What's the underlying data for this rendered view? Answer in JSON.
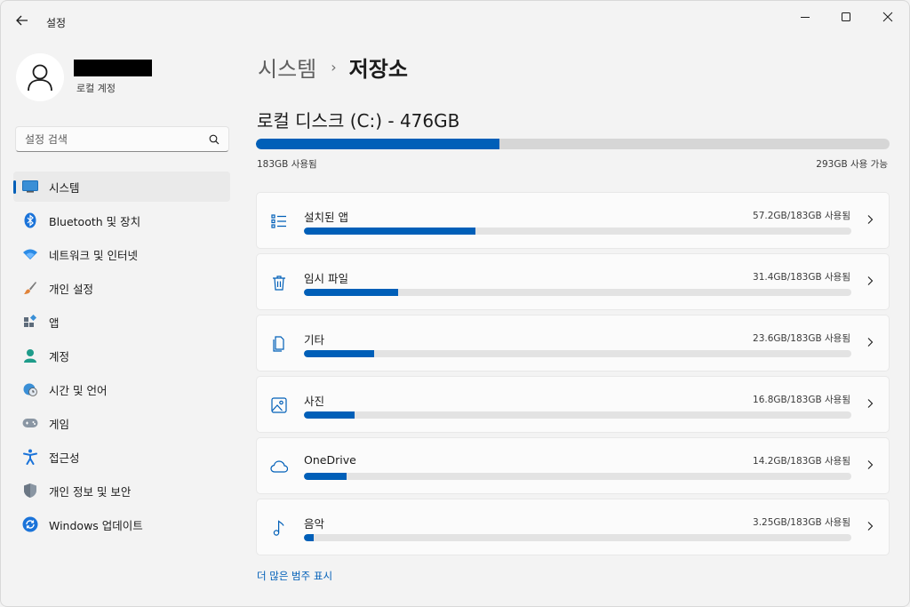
{
  "app": {
    "title": "설정"
  },
  "profile": {
    "subtitle": "로컬 계정"
  },
  "search": {
    "placeholder": "설정 검색"
  },
  "nav": {
    "items": [
      {
        "label": "시스템",
        "icon": "system-icon",
        "active": true
      },
      {
        "label": "Bluetooth 및 장치",
        "icon": "bluetooth-icon"
      },
      {
        "label": "네트워크 및 인터넷",
        "icon": "wifi-icon"
      },
      {
        "label": "개인 설정",
        "icon": "brush-icon"
      },
      {
        "label": "앱",
        "icon": "apps-icon"
      },
      {
        "label": "계정",
        "icon": "account-icon"
      },
      {
        "label": "시간 및 언어",
        "icon": "globe-clock-icon"
      },
      {
        "label": "게임",
        "icon": "gamepad-icon"
      },
      {
        "label": "접근성",
        "icon": "accessibility-icon"
      },
      {
        "label": "개인 정보 및 보안",
        "icon": "shield-icon"
      },
      {
        "label": "Windows 업데이트",
        "icon": "update-icon"
      }
    ]
  },
  "breadcrumb": {
    "parent": "시스템",
    "separator": "›",
    "current": "저장소"
  },
  "disk": {
    "title": "로컬 디스크 (C:) - 476GB",
    "used_label": "183GB 사용됨",
    "free_label": "293GB 사용 가능",
    "used_fraction": 0.3845
  },
  "categories": [
    {
      "label": "설치된 앱",
      "usage": "57.2GB/183GB 사용됨",
      "fraction": 0.3126,
      "icon": "apps-list-icon"
    },
    {
      "label": "임시 파일",
      "usage": "31.4GB/183GB 사용됨",
      "fraction": 0.1716,
      "icon": "trash-icon"
    },
    {
      "label": "기타",
      "usage": "23.6GB/183GB 사용됨",
      "fraction": 0.129,
      "icon": "documents-icon"
    },
    {
      "label": "사진",
      "usage": "16.8GB/183GB 사용됨",
      "fraction": 0.0918,
      "icon": "image-icon"
    },
    {
      "label": "OneDrive",
      "usage": "14.2GB/183GB 사용됨",
      "fraction": 0.0776,
      "icon": "cloud-icon"
    },
    {
      "label": "음악",
      "usage": "3.25GB/183GB 사용됨",
      "fraction": 0.0178,
      "icon": "music-icon"
    }
  ],
  "more_link": "더 많은 범주 표시",
  "colors": {
    "accent": "#005fb8",
    "track": "#e3e3e3",
    "background": "#f3f3f3"
  }
}
